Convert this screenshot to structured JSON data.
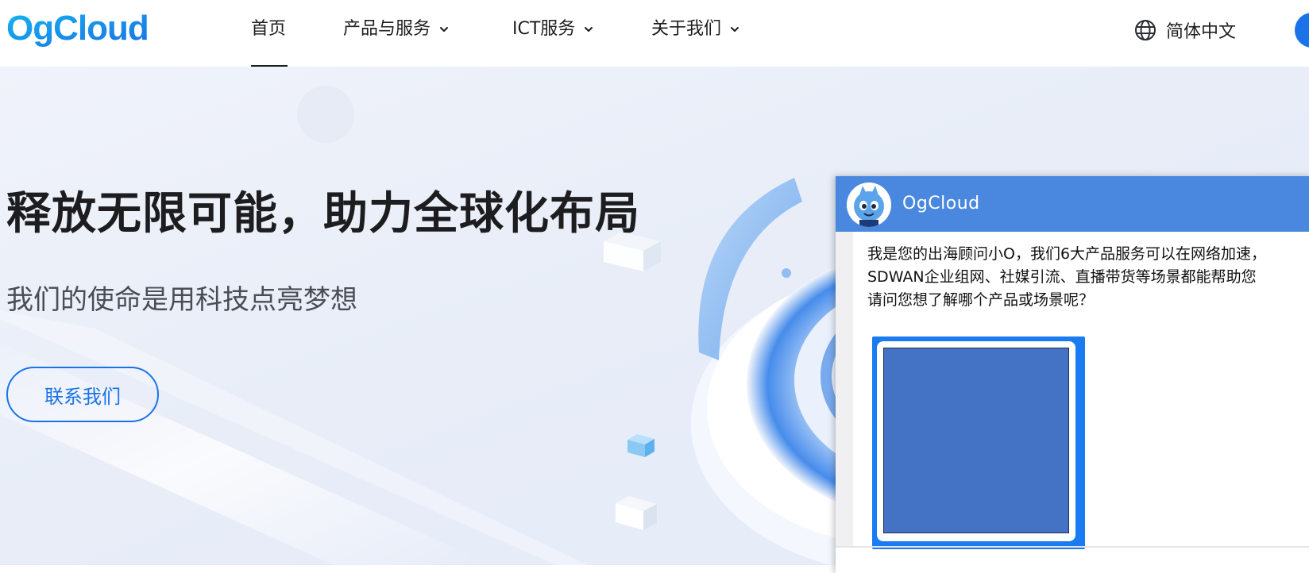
{
  "brand": {
    "logo_text": "OgCloud",
    "logo_color": "#1a73e8"
  },
  "nav": {
    "items": [
      {
        "label": "首页",
        "active": true,
        "dropdown": false
      },
      {
        "label": "产品与服务",
        "active": false,
        "dropdown": true
      },
      {
        "label": "ICT服务",
        "active": false,
        "dropdown": true
      },
      {
        "label": "关于我们",
        "active": false,
        "dropdown": true
      }
    ],
    "language": {
      "label": "简体中文",
      "icon": "globe-icon"
    }
  },
  "hero": {
    "title": "释放无限可能，助力全球化布局",
    "subtitle": "我们的使命是用科技点亮梦想",
    "cta_label": "联系我们",
    "accent_color": "#1a73e8"
  },
  "chat": {
    "header_color": "#4a88df",
    "agent_name": "OgCloud",
    "messages": [
      "我是您的出海顾问小O，我们6大产品服务可以在网络加速，SDWAN企业组网、社媒引流、直播带货等场景都能帮助您",
      "请问您想了解哪个产品或场景呢？"
    ],
    "image_color": "#4472c4"
  }
}
